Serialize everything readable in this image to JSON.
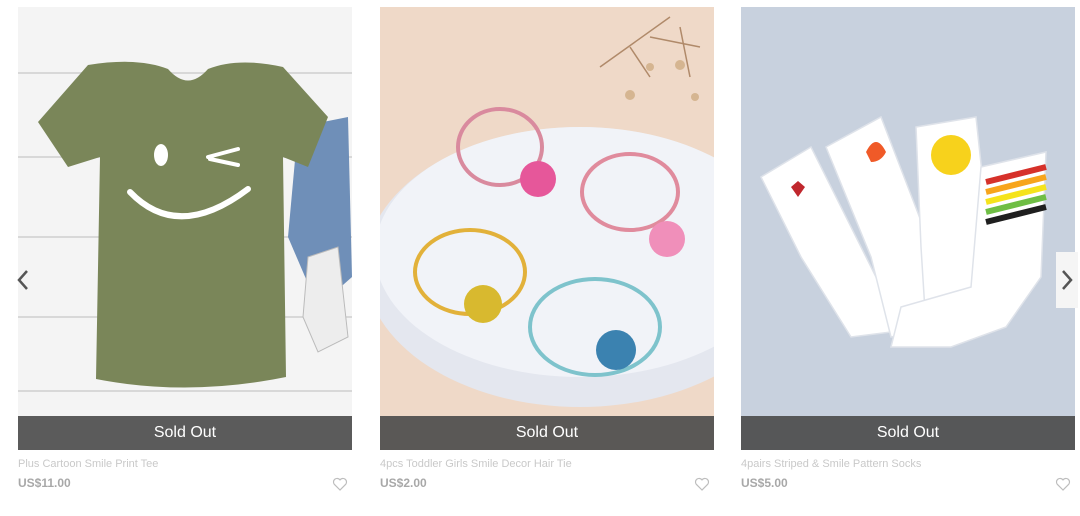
{
  "carousel": {
    "prev_icon": "chevron-left-icon",
    "next_icon": "chevron-right-icon",
    "products": [
      {
        "title": "Plus Cartoon Smile Print Tee",
        "price": "US$11.00",
        "status": "Sold Out",
        "wishlist_icon": "heart-outline-icon"
      },
      {
        "title": "4pcs Toddler Girls Smile Decor Hair Tie",
        "price": "US$2.00",
        "status": "Sold Out",
        "wishlist_icon": "heart-outline-icon"
      },
      {
        "title": "4pairs Striped & Smile Pattern Socks",
        "price": "US$5.00",
        "status": "Sold Out",
        "wishlist_icon": "heart-outline-icon"
      }
    ]
  },
  "colors": {
    "sold_overlay": "#464646",
    "muted_text": "#c9c9c9",
    "price_text": "#a8a8a8"
  }
}
